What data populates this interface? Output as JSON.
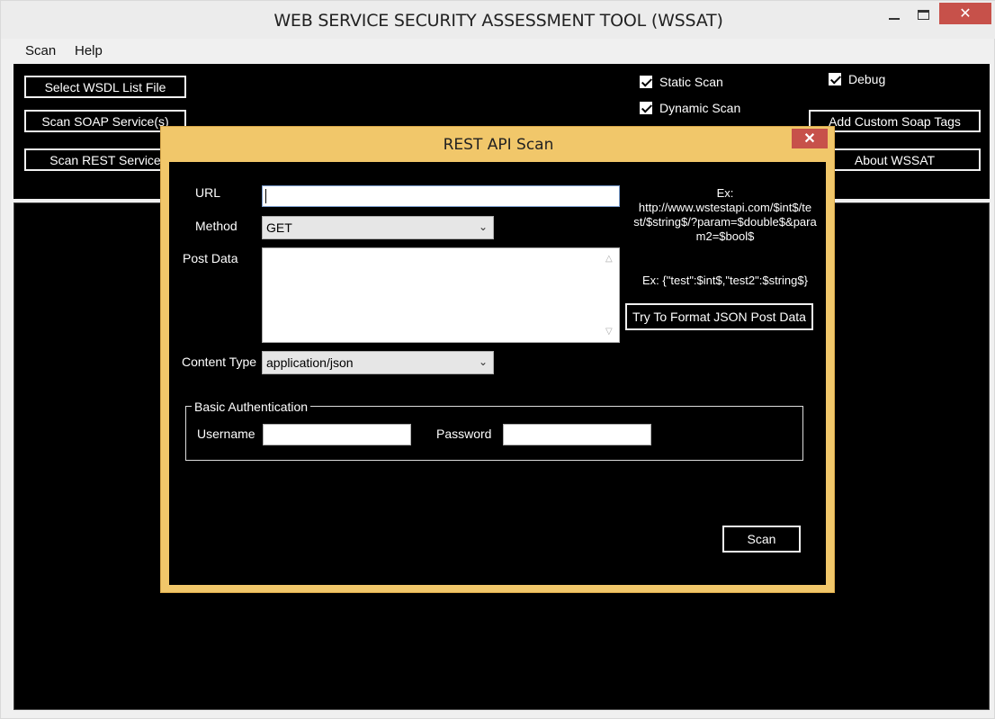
{
  "window": {
    "title": "WEB SERVICE SECURITY ASSESSMENT TOOL (WSSAT)",
    "close_glyph": "✕"
  },
  "menu": {
    "items": [
      {
        "label": "Scan"
      },
      {
        "label": "Help"
      }
    ]
  },
  "toolbar": {
    "select_wsdl_label": "Select WSDL List File",
    "scan_soap_label": "Scan SOAP Service(s)",
    "scan_rest_label": "Scan REST Service",
    "static_scan_label": "Static Scan",
    "static_scan_checked": true,
    "dynamic_scan_label": "Dynamic Scan",
    "dynamic_scan_checked": true,
    "debug_label": "Debug",
    "debug_checked": true,
    "add_custom_label": "Add Custom Soap Tags",
    "about_label": "About WSSAT"
  },
  "dialog": {
    "title": "REST API Scan",
    "close_glyph": "✕",
    "url_label": "URL",
    "url_value": "",
    "url_example": "Ex:\nhttp://www.wstestapi.com/$int$/test/$string$/?param=$double$&param2=$bool$",
    "url_example_line1": "Ex:",
    "url_example_line2": "http://www.wstestapi.com/$int$/te",
    "url_example_line3": "st/$string$/?param=$double$&para",
    "url_example_line4": "m2=$bool$",
    "method_label": "Method",
    "method_value": "GET",
    "post_data_label": "Post Data",
    "post_data_value": "",
    "json_example": "Ex: {\"test\":$int$,\"test2\":$string$}",
    "format_json_label": "Try To Format JSON Post Data",
    "content_type_label": "Content Type",
    "content_type_value": "application/json",
    "basic_auth_label": "Basic Authentication",
    "username_label": "Username",
    "username_value": "",
    "password_label": "Password",
    "password_value": "",
    "scan_button_label": "Scan"
  },
  "colors": {
    "dialog_border": "#f1c76a",
    "close_button": "#c7514a",
    "panel_background": "#000000"
  }
}
